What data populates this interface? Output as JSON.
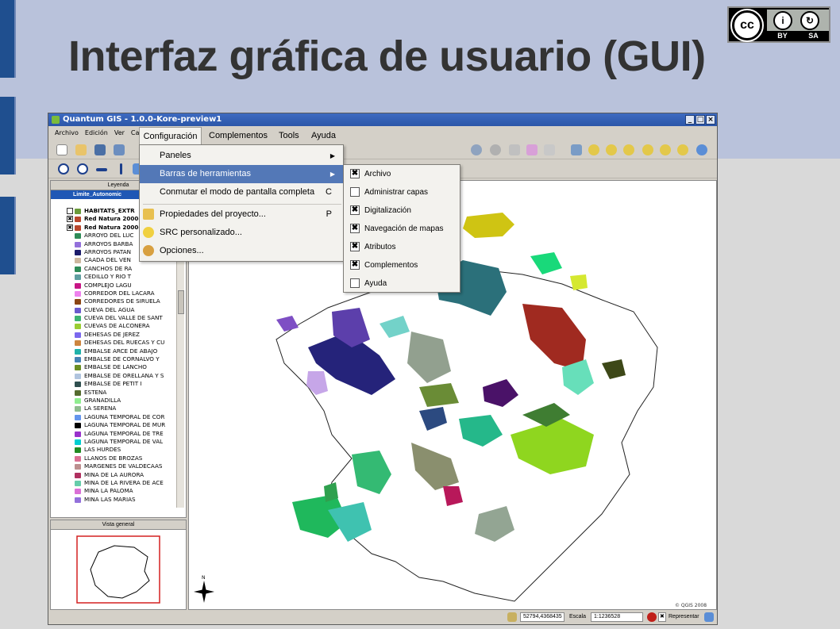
{
  "slide": {
    "title": "Interfaz gráfica de usuario (GUI)",
    "license": {
      "cc_label": "cc",
      "by_label": "BY",
      "sa_label": "SA",
      "by_symbol": "i",
      "sa_symbol": "↻"
    }
  },
  "window": {
    "title": "Quantum GIS - 1.0.0-Kore-preview1",
    "controls": [
      "_",
      "□",
      "×"
    ],
    "menubar": [
      "Archivo",
      "Edición",
      "Ver",
      "Capa"
    ],
    "menubar_open": "Configuración",
    "menubar_rest": [
      "Complementos",
      "Tools",
      "Ayuda"
    ]
  },
  "dropdown": {
    "items": [
      {
        "label": "Paneles",
        "submenu": true,
        "shortcut": ""
      },
      {
        "label": "Barras de herramientas",
        "submenu": true,
        "shortcut": "",
        "active": true
      },
      {
        "label": "Conmutar el modo de pantalla completa",
        "submenu": false,
        "shortcut": "C"
      },
      {
        "label": "Propiedades del proyecto...",
        "submenu": false,
        "shortcut": "P"
      },
      {
        "label": "SRC personalizado...",
        "submenu": false,
        "shortcut": ""
      },
      {
        "label": "Opciones...",
        "submenu": false,
        "shortcut": ""
      }
    ],
    "arrow": "▶"
  },
  "submenu": {
    "items": [
      {
        "label": "Archivo",
        "checked": true
      },
      {
        "label": "Administrar capas",
        "checked": false
      },
      {
        "label": "Digitalización",
        "checked": true
      },
      {
        "label": "Navegación de mapas",
        "checked": true
      },
      {
        "label": "Atributos",
        "checked": true
      },
      {
        "label": "Complementos",
        "checked": true
      },
      {
        "label": "Ayuda",
        "checked": false
      }
    ],
    "check_mark": "✖"
  },
  "legend": {
    "header": "Leyenda",
    "selected_layer": "Limite_Autonomic",
    "groups": [
      "HABITATS_EXTR",
      "Red Natura 2000-",
      "Red Natura 2000-"
    ],
    "layers": [
      "ARROYO DEL LUC",
      "ARROYOS BARBA",
      "ARROYOS PATAN",
      "CAADA DEL VEN",
      "CANCHOS DE RA",
      "CEDILLO Y RIO T",
      "COMPLEJO LAGU",
      "CORREDOR DEL LACARA",
      "CORREDORES DE SIRUELA",
      "CUEVA DEL AGUA",
      "CUEVA DEL VALLE DE SANT",
      "CUEVAS DE ALCONERA",
      "DEHESAS DE JEREZ",
      "DEHESAS DEL RUECAS Y CU",
      "EMBALSE ARCE DE ABAJO",
      "EMBALSE DE CORNALVO Y",
      "EMBALSE DE LANCHO",
      "EMBALSE DE ORELLANA Y S",
      "EMBALSE DE PETIT I",
      "ESTENA",
      "GRANADILLA",
      "LA SERENA",
      "LAGUNA TEMPORAL DE COR",
      "LAGUNA TEMPORAL DE MUR",
      "LAGUNA TEMPORAL DE TRE",
      "LAGUNA TEMPORAL DE VAL",
      "LAS HURDES",
      "LLANOS DE BROZAS",
      "MARGENES DE VALDECAAS",
      "MINA DE LA AURORA",
      "MINA DE LA RIVERA DE ACE",
      "MINA LA PALOMA",
      "MINA LAS MARIAS"
    ],
    "swatch_colors": [
      "#2e8b57",
      "#9370db",
      "#1c1c6b",
      "#cdb79e",
      "#2e8b57",
      "#5f9ea0",
      "#c71585",
      "#ee82ee",
      "#8b4513",
      "#6a5acd",
      "#3cb371",
      "#9acd32",
      "#7b68ee",
      "#cd853f",
      "#20b2aa",
      "#4682b4",
      "#6b8e23",
      "#b0c4de",
      "#2f4f4f",
      "#556b2f",
      "#90ee90",
      "#8fbc8f",
      "#6495ed",
      "#000000",
      "#9932cc",
      "#00ced1",
      "#228b22",
      "#db7093",
      "#bc8f8f",
      "#b03060",
      "#66cdaa",
      "#da70d6",
      "#9370db"
    ]
  },
  "overview": {
    "header": "Vista general"
  },
  "map": {
    "credit": "© QGIS 2008",
    "north_label": "N"
  },
  "status": {
    "coords": "52794,4368435",
    "scale_label": "Escala",
    "scale_value": "1:1236528",
    "render_label": "Representar"
  }
}
